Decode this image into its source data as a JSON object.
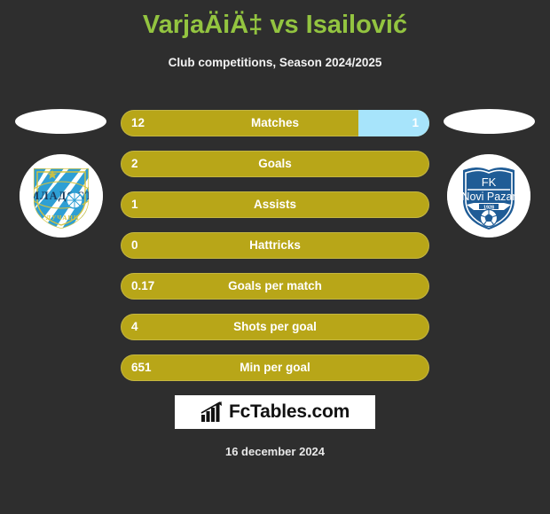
{
  "header": {
    "title": "VarjaÄiÄ‡ vs Isailović",
    "subtitle": "Club competitions, Season 2024/2025",
    "title_color": "#93c440"
  },
  "teams": {
    "home": {
      "name": "МЛАДОСТ",
      "logo": "fk-mladost-logo"
    },
    "away": {
      "name": "FK Novi Pazar",
      "logo": "fk-novi-pazar-logo"
    }
  },
  "colors": {
    "background": "#2e2e2e",
    "home_bar": "#b8a618",
    "away_bar": "#a7e4fb",
    "text": "#ffffff"
  },
  "chart_data": {
    "type": "bar",
    "title": "VarjaÄiÄ‡ vs Isailović",
    "subtitle": "Club competitions, Season 2024/2025",
    "orientation": "horizontal-diverging",
    "series": [
      {
        "name": "VarjaÄiÄ‡",
        "side": "left",
        "color": "#b8a618"
      },
      {
        "name": "Isailović",
        "side": "right",
        "color": "#a7e4fb"
      }
    ],
    "categories": [
      "Matches",
      "Goals",
      "Assists",
      "Hattricks",
      "Goals per match",
      "Shots per goal",
      "Min per goal"
    ],
    "rows": [
      {
        "label": "Matches",
        "home": "12",
        "away": "1",
        "home_pct": 77,
        "away_pct": 23
      },
      {
        "label": "Goals",
        "home": "2",
        "away": "",
        "home_pct": 100,
        "away_pct": 0
      },
      {
        "label": "Assists",
        "home": "1",
        "away": "",
        "home_pct": 100,
        "away_pct": 0
      },
      {
        "label": "Hattricks",
        "home": "0",
        "away": "",
        "home_pct": 100,
        "away_pct": 0
      },
      {
        "label": "Goals per match",
        "home": "0.17",
        "away": "",
        "home_pct": 100,
        "away_pct": 0
      },
      {
        "label": "Shots per goal",
        "home": "4",
        "away": "",
        "home_pct": 100,
        "away_pct": 0
      },
      {
        "label": "Min per goal",
        "home": "651",
        "away": "",
        "home_pct": 100,
        "away_pct": 0
      }
    ]
  },
  "footer": {
    "brand": "FcTables.com",
    "brand_icon": "bar-chart-growth-icon",
    "date": "16 december 2024"
  }
}
